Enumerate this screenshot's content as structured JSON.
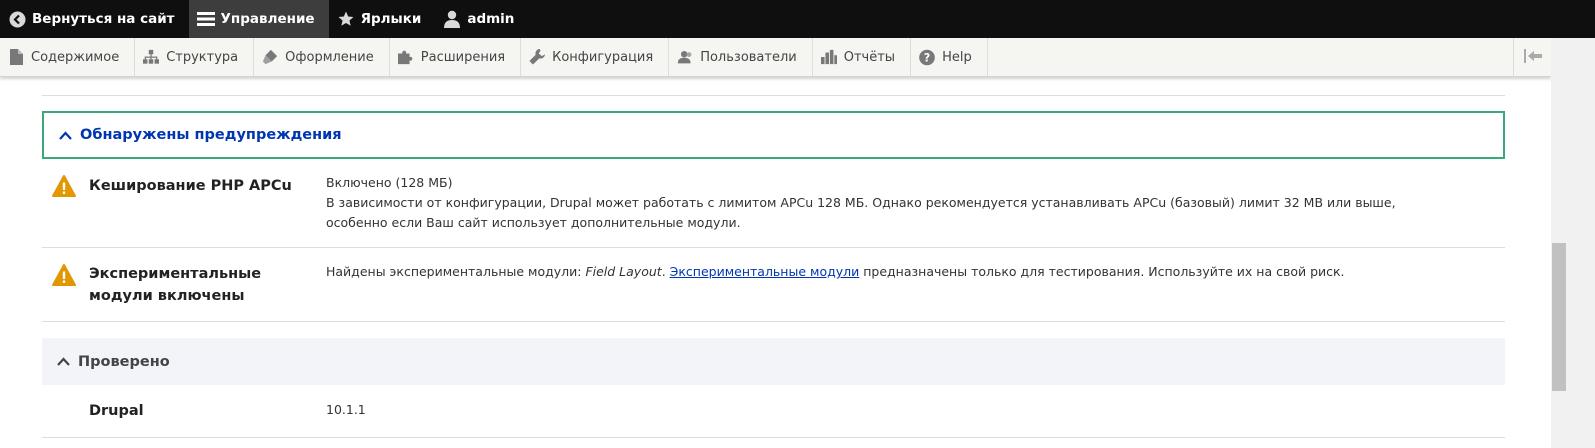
{
  "toolbar": {
    "back": "Вернуться на сайт",
    "manage": "Управление",
    "shortcuts": "Ярлыки",
    "user": "admin"
  },
  "tray": {
    "items": [
      "Содержимое",
      "Структура",
      "Оформление",
      "Расширения",
      "Конфигурация",
      "Пользователи",
      "Отчёты",
      "Help"
    ]
  },
  "report": {
    "warnings_title": "Обнаружены предупреждения",
    "apcu_label": "Кеширование PHP APCu",
    "apcu_value": "Включено (128 МБ)",
    "apcu_desc": "В зависимости от конфигурации, Drupal может работать с лимитом APCu 128 МБ. Однако рекомендуется устанавливать APCu (базовый) лимит 32 MB или выше, особенно если Ваш сайт использует дополнительные модули.",
    "exp_label": "Экспериментальные модули включены",
    "exp_prefix": "Найдены экспериментальные модули: ",
    "exp_module": "Field Layout",
    "exp_mid": ". ",
    "exp_link": "Экспериментальные модули",
    "exp_suffix": " предназначены только для тестирования. Используйте их на свой риск.",
    "checked_title": "Проверено",
    "drupal_label": "Drupal",
    "drupal_value": "10.1.1"
  },
  "colors": {
    "accent_border": "#3aa87a",
    "link": "#0036b1",
    "warning": "#e29700"
  }
}
